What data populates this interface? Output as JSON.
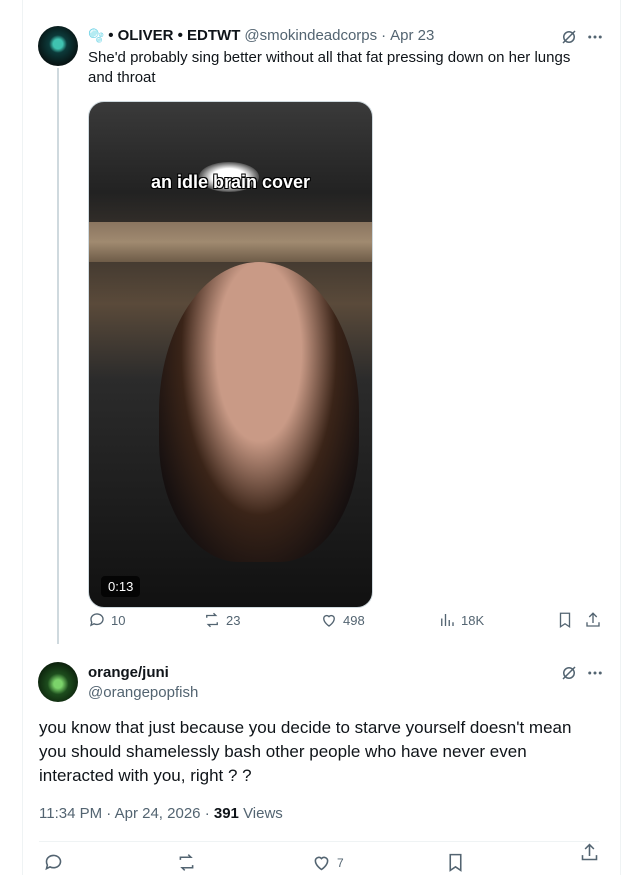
{
  "quoted_tweet": {
    "emoji": "🫧",
    "name": "• OLIVER • EDTWT",
    "handle": "@smokindeadcorps",
    "separator": "·",
    "date": "Apr 23",
    "text": "She'd probably sing better without all that fat pressing down on her lungs and throat",
    "media": {
      "caption": "an idle brain cover",
      "duration": "0:13"
    },
    "stats": {
      "replies": "10",
      "reposts": "23",
      "likes": "498",
      "views": "18K"
    }
  },
  "focus_tweet": {
    "name": "orange/juni",
    "handle": "@orangepopfish",
    "text": "you know that just because you decide to starve yourself doesn't mean you should shamelessly bash other people who have never even interacted with you, right ? ?",
    "time": "11:34 PM",
    "separator": "·",
    "date": "Apr 24, 2026",
    "views_count": "391",
    "views_label": "Views",
    "likes": "7"
  },
  "colors": {
    "text": "#0f1419",
    "muted": "#536471",
    "border": "#eff3f4"
  },
  "icons": [
    "grok-icon",
    "more-icon",
    "reply-icon",
    "repost-icon",
    "like-icon",
    "views-icon",
    "bookmark-icon",
    "share-icon"
  ]
}
